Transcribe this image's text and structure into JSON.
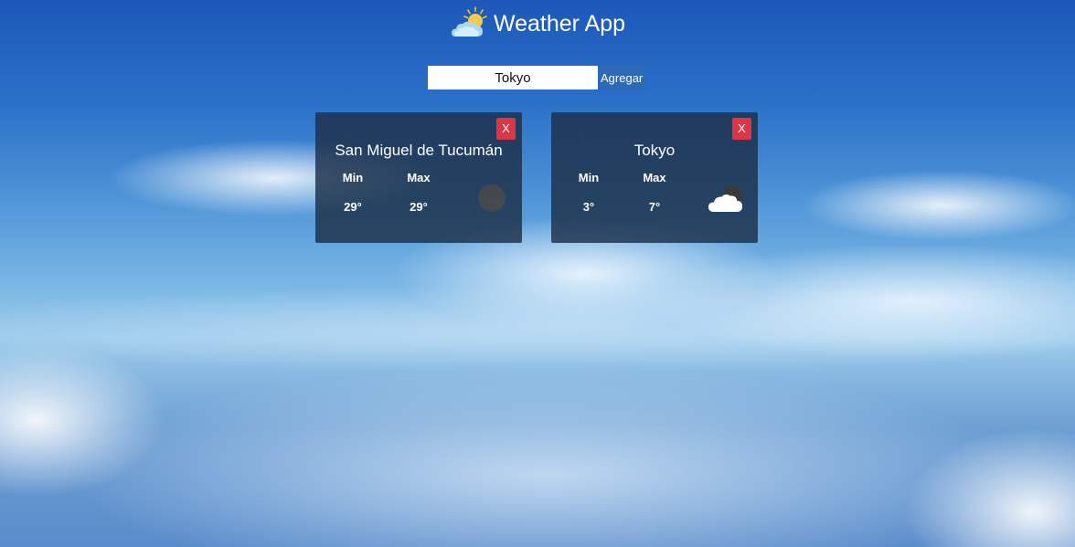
{
  "header": {
    "title": "Weather App",
    "logo_icon": "sun-behind-cloud-icon"
  },
  "search": {
    "value": "Tokyo",
    "button_label": "Agregar"
  },
  "cards": [
    {
      "city": "San Miguel de Tucumán",
      "close_label": "X",
      "min_label": "Min",
      "max_label": "Max",
      "min_value": "29°",
      "max_value": "29°",
      "icon": "dark-moon-icon"
    },
    {
      "city": "Tokyo",
      "close_label": "X",
      "min_label": "Min",
      "max_label": "Max",
      "min_value": "3°",
      "max_value": "7°",
      "icon": "cloudy-night-icon"
    }
  ],
  "colors": {
    "close_button": "#dc3545",
    "add_button": "#2e69b4",
    "card_background": "#1c3048"
  }
}
